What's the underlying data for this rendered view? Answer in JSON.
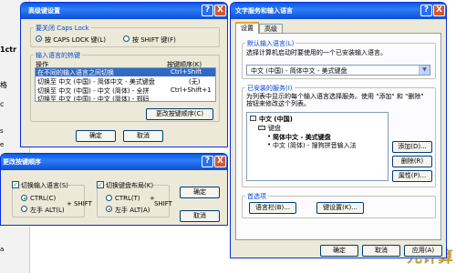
{
  "background": {
    "left_edge": [
      "1ctr",
      "格",
      "c",
      "s",
      "e",
      "a"
    ],
    "right_texts": [
      "元计算"
    ]
  },
  "adv_keys": {
    "title": "高级键设置",
    "caps_group": {
      "label": "要关闭 Caps Lock",
      "options": [
        "按 CAPS LOCK 键(L)",
        "按 SHIFT 键(F)"
      ],
      "selected": 0
    },
    "hotkey_group": {
      "label": "输入语言的热键",
      "columns": [
        "操作",
        "按键顺序(K)"
      ],
      "rows": [
        {
          "action": "在不同的输入语言之间切换",
          "keys": "Ctrl+Shift",
          "selected": true
        },
        {
          "action": "切换至 中文 (中国) - 简体中文 - 美式键盘",
          "keys": "(无)",
          "selected": false
        },
        {
          "action": "切换至 中文 (中国) - 中文 (简体) - 全拼",
          "keys": "Ctrl+Shift+1",
          "selected": false
        },
        {
          "action": "切换至 中文 (中国) - 中文 (简体) - 郑码",
          "keys": "",
          "selected": false
        }
      ],
      "change_button": "更改按键顺序(C)"
    },
    "ok": "确定",
    "cancel": "取消",
    "help_icon": "?",
    "close_icon": "X"
  },
  "change_seq": {
    "title": "更改按键顺序",
    "switch_lang": {
      "label": "切换输入语言(S)",
      "checked": true,
      "options": [
        "CTRL(C)",
        "左手 ALT(L)"
      ],
      "selected": 0,
      "plus": "+",
      "shift": "SHIFT"
    },
    "switch_layout": {
      "label": "切换键盘布局(K)",
      "checked": true,
      "options": [
        "CTRL(T)",
        "左手 ALT(A)"
      ],
      "selected": 1,
      "plus": "+",
      "shift": "SHIFT"
    },
    "ok": "确定",
    "cancel": "取消",
    "help_icon": "?",
    "close_icon": "X"
  },
  "text_services": {
    "title": "文字服务和输入语言",
    "tabs": [
      "设置",
      "高级"
    ],
    "active_tab": 0,
    "default_lang": {
      "label": "默认输入语言(L)",
      "desc": "选择计算机启动时要使用的一个已安装输入语言。",
      "value": "中文 (中国) - 简体中文 - 美式键盘"
    },
    "installed": {
      "label": "已安装的服务(I)",
      "desc": "为列表中显示的每个输入语言选择服务。使用 \"添加\" 和 \"删除\" 按钮来修改这个列表。",
      "tree": [
        "中文 (中国)",
        "键盘",
        "简体中文 - 美式键盘",
        "中文 (简体) - 搜狗拼音输入法"
      ],
      "add": "添加(D)...",
      "remove": "删除(R)",
      "props": "属性(P)..."
    },
    "prefs": {
      "label": "首选项",
      "lang_bar": "语言栏(B)...",
      "key_settings": "键设置(K)..."
    },
    "ok": "确定",
    "cancel": "取消",
    "apply": "应用(A)",
    "help_icon": "?",
    "close_icon": "X"
  }
}
